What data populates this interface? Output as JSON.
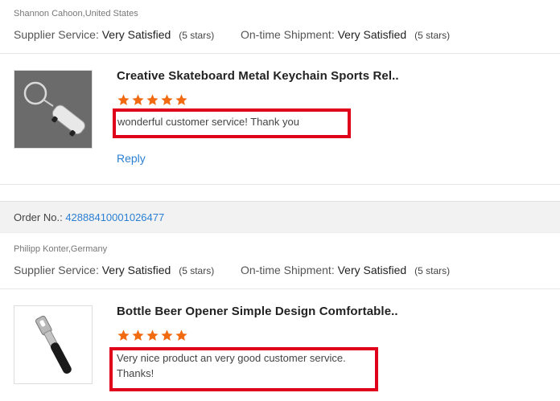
{
  "reviews": [
    {
      "reviewer": "Shannon Cahoon,United States",
      "supplier_label": "Supplier Service:",
      "supplier_value": "Very Satisfied",
      "supplier_stars": "(5 stars)",
      "shipment_label": "On-time Shipment:",
      "shipment_value": "Very Satisfied",
      "shipment_stars": "(5 stars)",
      "product_title": "Creative Skateboard Metal Keychain Sports Rel...",
      "rating": 5,
      "feedback": "wonderful customer service! Thank you",
      "reply_label": "Reply"
    },
    {
      "order_label": "Order No.:",
      "order_number": "42888410001026477",
      "reviewer": "Philipp Konter,Germany",
      "supplier_label": "Supplier Service:",
      "supplier_value": "Very Satisfied",
      "supplier_stars": "(5 stars)",
      "shipment_label": "On-time Shipment:",
      "shipment_value": "Very Satisfied",
      "shipment_stars": "(5 stars)",
      "product_title": "Bottle Beer Opener Simple Design Comfortable...",
      "rating": 5,
      "feedback": "Very nice product an very good customer service. Thanks!"
    }
  ],
  "colors": {
    "star": "#f26a10",
    "link": "#2a7fd4",
    "highlight_box": "#e0001b"
  },
  "icons": {
    "star": "star-icon"
  }
}
